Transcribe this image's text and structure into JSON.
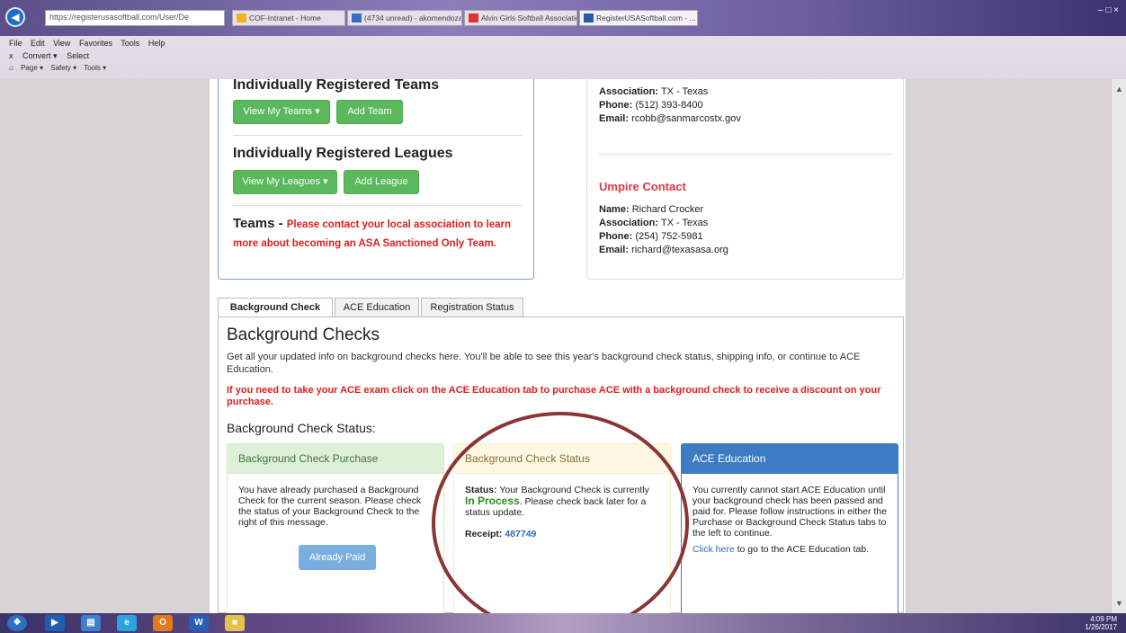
{
  "browser": {
    "address": "https://registerusasoftball.com/User/De",
    "tabs": [
      {
        "label": "COF-Intranet - Home"
      },
      {
        "label": "(4734 unread) - akomendoza8..."
      },
      {
        "label": "Alvin Girls Softball Association ..."
      },
      {
        "label": "RegisterUSASoftball.com - ..."
      }
    ],
    "window_controls": "– □ ×",
    "menu": [
      "File",
      "Edit",
      "View",
      "Favorites",
      "Tools",
      "Help"
    ],
    "command": [
      "x",
      "Convert ▾",
      "Select"
    ],
    "favorites": [
      "Page ▾",
      "Safety ▾",
      "Tools ▾"
    ]
  },
  "left_panel": {
    "teams_heading": "Individually Registered Teams",
    "view_my_teams": "View My Teams ▾",
    "add_team": "Add Team",
    "leagues_heading": "Individually Registered Leagues",
    "view_my_leagues": "View My Leagues ▾",
    "add_league": "Add League",
    "teams_label": "Teams - ",
    "teams_note": "Please contact your local association to learn more about becoming an ASA Sanctioned Only Team."
  },
  "right_panel": {
    "contact1": {
      "association_label": "Association:",
      "association": "TX - Texas",
      "phone_label": "Phone:",
      "phone": "(512) 393-8400",
      "email_label": "Email:",
      "email": "rcobb@sanmarcostx.gov"
    },
    "umpire_heading": "Umpire Contact",
    "contact2": {
      "name_label": "Name:",
      "name": "Richard Crocker",
      "association_label": "Association:",
      "association": "TX - Texas",
      "phone_label": "Phone:",
      "phone": "(254) 752-5981",
      "email_label": "Email:",
      "email": "richard@texasasa.org"
    }
  },
  "tabs": {
    "background_check": "Background Check",
    "ace_education": "ACE Education",
    "registration_status": "Registration Status"
  },
  "background": {
    "title": "Background Checks",
    "description": "Get all your updated info on background checks here. You'll be able to see this year's background check status, shipping info, or continue to ACE Education.",
    "ace_note": "If you need to take your ACE exam click on the ACE Education tab to purchase ACE with a background check to receive a discount on your purchase.",
    "status_heading": "Background Check Status:",
    "purchase_card": {
      "title": "Background Check Purchase",
      "body": "You have already purchased a Background Check for the current season. Please check the status of your Background Check to the right of this message.",
      "button": "Already Paid"
    },
    "status_card": {
      "title": "Background Check Status",
      "status_label": "Status:",
      "status_pre": " Your Background Check is currently ",
      "status_value": "In Process",
      "status_post": ". Please check back later for a status update.",
      "receipt_label": "Receipt:",
      "receipt_value": "487749"
    },
    "ace_card": {
      "title": "ACE Education",
      "body": "You currently cannot start ACE Education until your background check has been passed and paid for. Please follow instructions in either the Purchase or Background Check Status tabs to the left to continue.",
      "link": "Click here",
      "link_post": " to go to the ACE Education tab."
    }
  },
  "taskbar": {
    "time": "4:09 PM",
    "date": "1/26/2017",
    "word_icon_label": "W"
  },
  "colors": {
    "green_button": "#5cb85c",
    "alert_red": "#e01e1e",
    "link_blue": "#2a6fb8",
    "annotation": "#8b3434"
  }
}
